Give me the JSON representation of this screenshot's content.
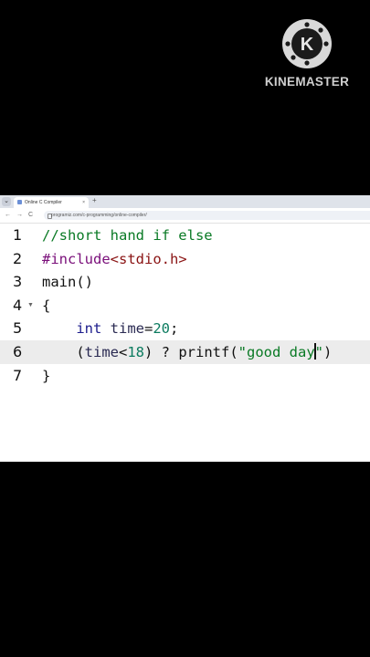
{
  "watermark": {
    "brand": "KINEMASTER",
    "logo_letter": "K"
  },
  "browser": {
    "tab_title": "Online C Compiler",
    "tab_close": "×",
    "new_tab": "+",
    "tab_menu": "⌄",
    "nav_back": "←",
    "nav_forward": "→",
    "nav_reload": "C",
    "nav_home": "⌂",
    "url": "programiz.com/c-programming/online-compiler/"
  },
  "editor": {
    "lines": [
      {
        "num": "1",
        "parts": [
          {
            "cls": "cm",
            "text": "//short hand if else"
          }
        ]
      },
      {
        "num": "2",
        "parts": [
          {
            "cls": "kw",
            "text": "#include"
          },
          {
            "cls": "tag",
            "text": "<stdio.h>"
          }
        ]
      },
      {
        "num": "3",
        "parts": [
          {
            "cls": "",
            "text": "main()"
          }
        ]
      },
      {
        "num": "4",
        "fold": "▼",
        "parts": [
          {
            "cls": "",
            "text": "{"
          }
        ]
      },
      {
        "num": "5",
        "parts": [
          {
            "cls": "",
            "text": "    "
          },
          {
            "cls": "ty",
            "text": "int"
          },
          {
            "cls": "",
            "text": " "
          },
          {
            "cls": "var",
            "text": "time"
          },
          {
            "cls": "",
            "text": "="
          },
          {
            "cls": "num",
            "text": "20"
          },
          {
            "cls": "",
            "text": ";"
          }
        ]
      },
      {
        "num": "6",
        "active": true,
        "parts": [
          {
            "cls": "",
            "text": "    ("
          },
          {
            "cls": "var",
            "text": "time"
          },
          {
            "cls": "",
            "text": "<"
          },
          {
            "cls": "num",
            "text": "18"
          },
          {
            "cls": "",
            "text": ") ? printf("
          },
          {
            "cls": "str",
            "text": "\"good day"
          },
          {
            "cursor": true
          },
          {
            "cls": "str",
            "text": "\""
          },
          {
            "cls": "",
            "text": ")"
          }
        ]
      },
      {
        "num": "7",
        "parts": [
          {
            "cls": "",
            "text": "}"
          }
        ]
      }
    ]
  }
}
